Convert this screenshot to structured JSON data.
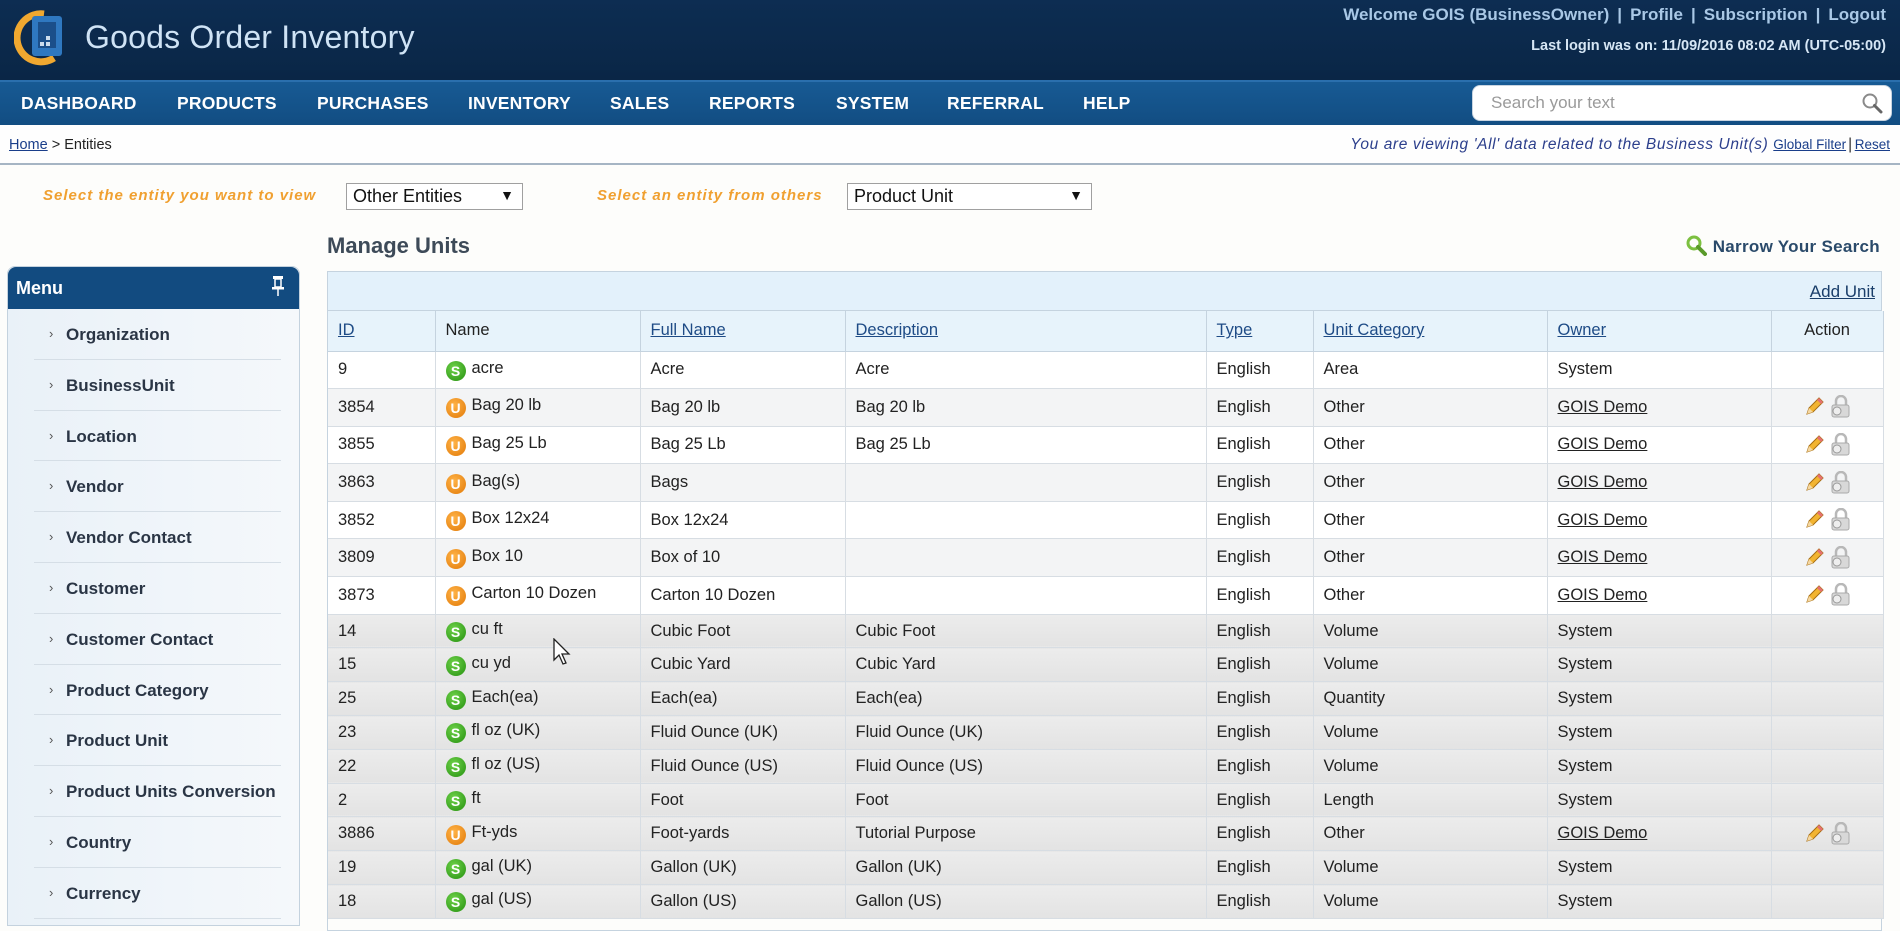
{
  "header": {
    "app_title": "Goods Order Inventory",
    "welcome": "Welcome GOIS (BusinessOwner)",
    "links": [
      "Profile",
      "Subscription",
      "Logout"
    ],
    "last_login": "Last login was on: 11/09/2016 08:02 AM (UTC-05:00)"
  },
  "nav": {
    "items": [
      "DASHBOARD",
      "PRODUCTS",
      "PURCHASES",
      "INVENTORY",
      "SALES",
      "REPORTS",
      "SYSTEM",
      "REFERRAL",
      "HELP"
    ],
    "search_placeholder": "Search your text"
  },
  "breadcrumb": {
    "home": "Home",
    "separator": " > ",
    "current": "Entities"
  },
  "filter": {
    "text": "You are viewing 'All' data related to the Business Unit(s)",
    "global_filter": "Global Filter",
    "reset": "Reset"
  },
  "selectors": {
    "entity_label": "Select the entity you want to view",
    "entity_value": "Other Entities",
    "other_label": "Select an entity from others",
    "other_value": "Product Unit"
  },
  "page": {
    "title": "Manage Units",
    "narrow_search": "Narrow Your Search",
    "add_unit": "Add Unit"
  },
  "menu": {
    "title": "Menu",
    "items": [
      "Organization",
      "BusinessUnit",
      "Location",
      "Vendor",
      "Vendor Contact",
      "Customer",
      "Customer Contact",
      "Product Category",
      "Product Unit",
      "Product Units Conversion",
      "Country",
      "Currency"
    ]
  },
  "table": {
    "columns": [
      "ID",
      "Name",
      "Full Name",
      "Description",
      "Type",
      "Unit Category",
      "Owner",
      "Action"
    ],
    "rows": [
      {
        "id": "9",
        "badge": "S",
        "name": "acre",
        "full_name": "Acre",
        "description": "Acre",
        "type": "English",
        "category": "Area",
        "owner": "System",
        "editable": false
      },
      {
        "id": "3854",
        "badge": "U",
        "name": "Bag 20 lb",
        "full_name": "Bag 20 lb",
        "description": "Bag 20 lb",
        "type": "English",
        "category": "Other",
        "owner": "GOIS Demo",
        "editable": true
      },
      {
        "id": "3855",
        "badge": "U",
        "name": "Bag 25 Lb",
        "full_name": "Bag 25 Lb",
        "description": "Bag 25 Lb",
        "type": "English",
        "category": "Other",
        "owner": "GOIS Demo",
        "editable": true
      },
      {
        "id": "3863",
        "badge": "U",
        "name": "Bag(s)",
        "full_name": "Bags",
        "description": "",
        "type": "English",
        "category": "Other",
        "owner": "GOIS Demo",
        "editable": true
      },
      {
        "id": "3852",
        "badge": "U",
        "name": "Box 12x24",
        "full_name": "Box 12x24",
        "description": "",
        "type": "English",
        "category": "Other",
        "owner": "GOIS Demo",
        "editable": true
      },
      {
        "id": "3809",
        "badge": "U",
        "name": "Box 10",
        "full_name": "Box of 10",
        "description": "",
        "type": "English",
        "category": "Other",
        "owner": "GOIS Demo",
        "editable": true
      },
      {
        "id": "3873",
        "badge": "U",
        "name": "Carton 10 Dozen",
        "full_name": "Carton 10 Dozen",
        "description": "",
        "type": "English",
        "category": "Other",
        "owner": "GOIS Demo",
        "editable": true
      },
      {
        "id": "14",
        "badge": "S",
        "name": "cu ft",
        "full_name": "Cubic Foot",
        "description": "Cubic Foot",
        "type": "English",
        "category": "Volume",
        "owner": "System",
        "editable": false
      },
      {
        "id": "15",
        "badge": "S",
        "name": "cu yd",
        "full_name": "Cubic Yard",
        "description": "Cubic Yard",
        "type": "English",
        "category": "Volume",
        "owner": "System",
        "editable": false
      },
      {
        "id": "25",
        "badge": "S",
        "name": "Each(ea)",
        "full_name": "Each(ea)",
        "description": "Each(ea)",
        "type": "English",
        "category": "Quantity",
        "owner": "System",
        "editable": false
      },
      {
        "id": "23",
        "badge": "S",
        "name": "fl oz (UK)",
        "full_name": "Fluid Ounce (UK)",
        "description": "Fluid Ounce (UK)",
        "type": "English",
        "category": "Volume",
        "owner": "System",
        "editable": false
      },
      {
        "id": "22",
        "badge": "S",
        "name": "fl oz (US)",
        "full_name": "Fluid Ounce (US)",
        "description": "Fluid Ounce (US)",
        "type": "English",
        "category": "Volume",
        "owner": "System",
        "editable": false
      },
      {
        "id": "2",
        "badge": "S",
        "name": "ft",
        "full_name": "Foot",
        "description": "Foot",
        "type": "English",
        "category": "Length",
        "owner": "System",
        "editable": false
      },
      {
        "id": "3886",
        "badge": "U",
        "name": "Ft-yds",
        "full_name": "Foot-yards",
        "description": "Tutorial Purpose",
        "type": "English",
        "category": "Other",
        "owner": "GOIS Demo",
        "editable": true
      },
      {
        "id": "19",
        "badge": "S",
        "name": "gal (UK)",
        "full_name": "Gallon (UK)",
        "description": "Gallon (UK)",
        "type": "English",
        "category": "Volume",
        "owner": "System",
        "editable": false
      },
      {
        "id": "18",
        "badge": "S",
        "name": "gal (US)",
        "full_name": "Gallon (US)",
        "description": "Gallon (US)",
        "type": "English",
        "category": "Volume",
        "owner": "System",
        "editable": false
      }
    ]
  },
  "colors": {
    "header_bg": "#0b2a4a",
    "nav_bg": "#124d82",
    "label_orange": "#f0a030",
    "system_badge": "#3aa320",
    "user_badge": "#ea8a1a"
  }
}
